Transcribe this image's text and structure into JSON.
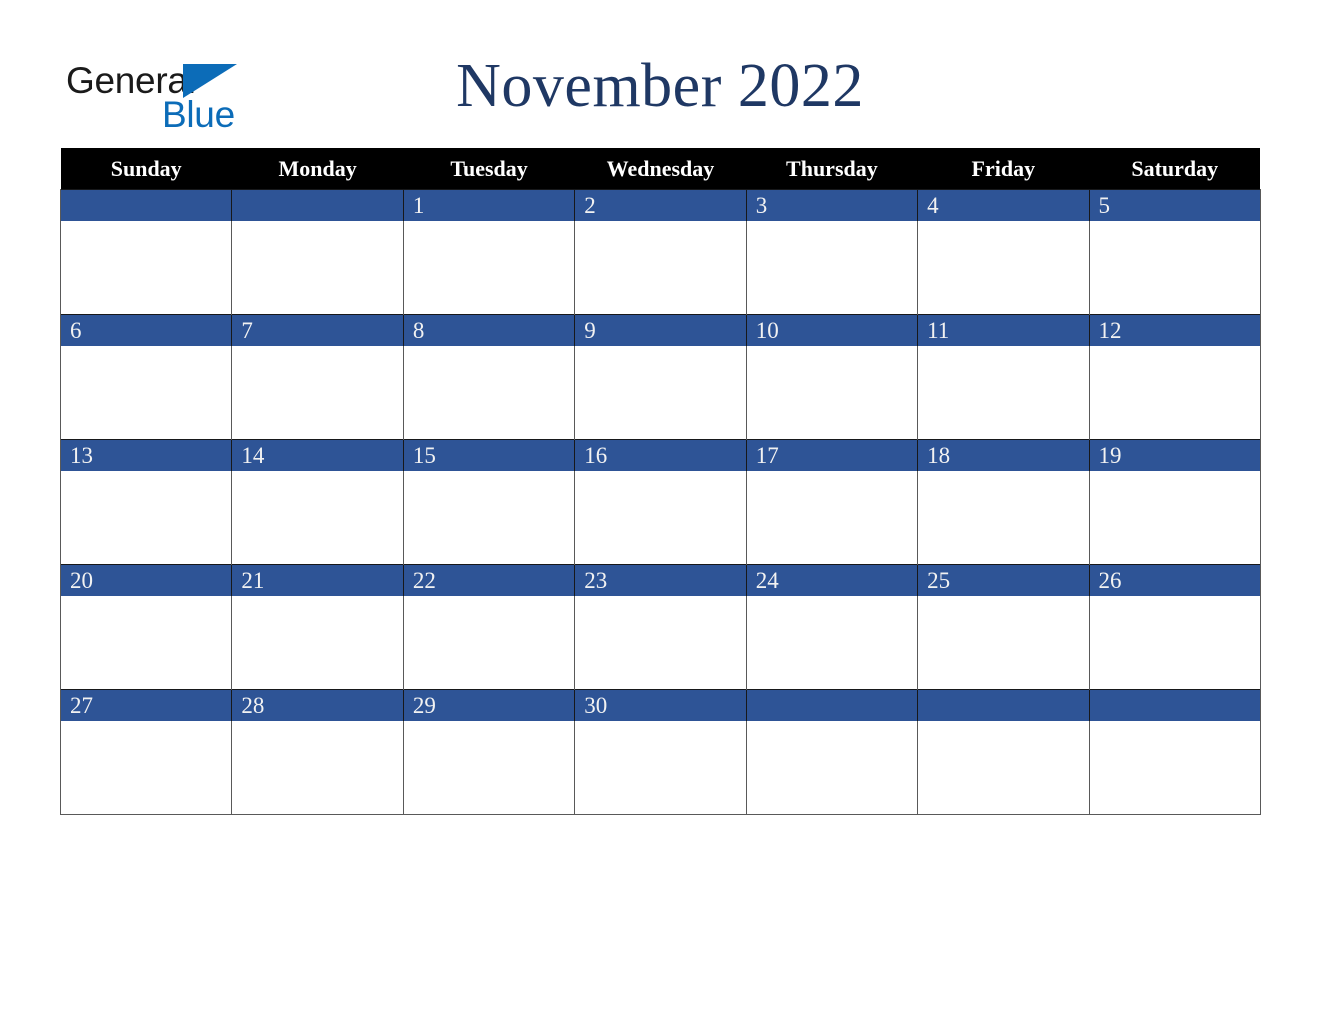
{
  "branding": {
    "logo_word_1": "General",
    "logo_word_2": "Blue",
    "logo_triangle_icon": "triangle-icon",
    "logo_blue_hex": "#0C6CB8",
    "logo_text_hex": "#1a1a1a"
  },
  "header": {
    "title": "November 2022",
    "title_color_hex": "#1F3864"
  },
  "colors": {
    "dow_header_bg_hex": "#000000",
    "dow_header_text_hex": "#FFFFFF",
    "date_band_bg_hex": "#2E5496",
    "date_band_text_hex": "#F2F2F2",
    "cell_bg_hex": "#FFFFFF",
    "grid_line_hex": "#595959"
  },
  "calendar": {
    "month": "November",
    "year": "2022",
    "day_headers": [
      "Sunday",
      "Monday",
      "Tuesday",
      "Wednesday",
      "Thursday",
      "Friday",
      "Saturday"
    ],
    "weeks": [
      {
        "days": [
          {
            "num": "",
            "note": ""
          },
          {
            "num": "",
            "note": ""
          },
          {
            "num": "1",
            "note": ""
          },
          {
            "num": "2",
            "note": ""
          },
          {
            "num": "3",
            "note": ""
          },
          {
            "num": "4",
            "note": ""
          },
          {
            "num": "5",
            "note": ""
          }
        ]
      },
      {
        "days": [
          {
            "num": "6",
            "note": ""
          },
          {
            "num": "7",
            "note": ""
          },
          {
            "num": "8",
            "note": ""
          },
          {
            "num": "9",
            "note": ""
          },
          {
            "num": "10",
            "note": ""
          },
          {
            "num": "11",
            "note": ""
          },
          {
            "num": "12",
            "note": ""
          }
        ]
      },
      {
        "days": [
          {
            "num": "13",
            "note": ""
          },
          {
            "num": "14",
            "note": ""
          },
          {
            "num": "15",
            "note": ""
          },
          {
            "num": "16",
            "note": ""
          },
          {
            "num": "17",
            "note": ""
          },
          {
            "num": "18",
            "note": ""
          },
          {
            "num": "19",
            "note": ""
          }
        ]
      },
      {
        "days": [
          {
            "num": "20",
            "note": ""
          },
          {
            "num": "21",
            "note": ""
          },
          {
            "num": "22",
            "note": ""
          },
          {
            "num": "23",
            "note": ""
          },
          {
            "num": "24",
            "note": ""
          },
          {
            "num": "25",
            "note": ""
          },
          {
            "num": "26",
            "note": ""
          }
        ]
      },
      {
        "days": [
          {
            "num": "27",
            "note": ""
          },
          {
            "num": "28",
            "note": ""
          },
          {
            "num": "29",
            "note": ""
          },
          {
            "num": "30",
            "note": ""
          },
          {
            "num": "",
            "note": ""
          },
          {
            "num": "",
            "note": ""
          },
          {
            "num": "",
            "note": ""
          }
        ]
      }
    ]
  }
}
